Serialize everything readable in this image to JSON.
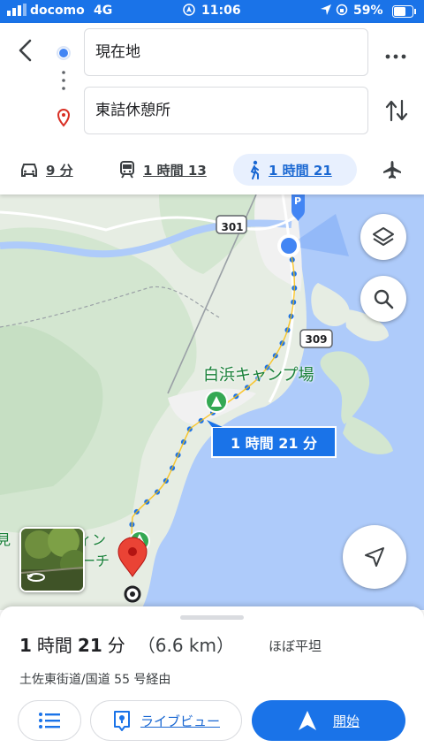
{
  "status": {
    "carrier": "docomo",
    "network": "4G",
    "time": "11:06",
    "battery": "59%"
  },
  "route": {
    "origin": "現在地",
    "destination": "東詰休憩所"
  },
  "modes": [
    {
      "icon": "car-icon",
      "label": "9 分"
    },
    {
      "icon": "train-icon",
      "label": "1 時間 13"
    },
    {
      "icon": "walk-icon",
      "label": "1 時間 21",
      "active": true
    },
    {
      "icon": "plane-icon",
      "label": ""
    }
  ],
  "map": {
    "road_labels": [
      "301",
      "309"
    ],
    "place_label": "白浜キャンプ場",
    "route_bubble": "1 時間 21 分",
    "partial_label_left": "見",
    "partial_label_1": "ィン",
    "partial_label_2": "ーチ",
    "parking_label": "P",
    "colors": {
      "land": "#e8eee4",
      "forest": "#cfe3cd",
      "water": "#aecbfa",
      "route": "#1a73e8"
    }
  },
  "summary": {
    "duration_h": "1",
    "duration_h_unit": "時間",
    "duration_m": "21",
    "duration_m_unit": "分",
    "distance": "（6.6 km）",
    "terrain": "ほぼ平坦",
    "via": "土佐東街道/国道 55 号経由"
  },
  "buttons": {
    "live_view": "ライブビュー",
    "start": "開始"
  }
}
